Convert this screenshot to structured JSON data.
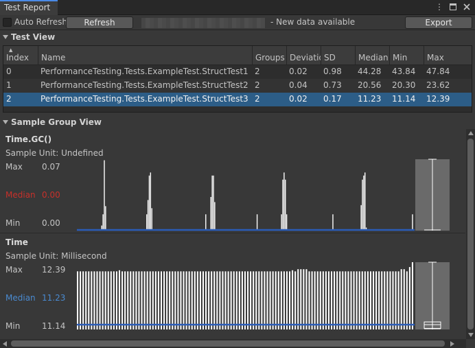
{
  "window": {
    "tab_title": "Test Report",
    "tab_controls": {
      "menu": "⋮"
    }
  },
  "toolbar": {
    "auto_refresh_label": "Auto Refresh",
    "refresh_label": "Refresh",
    "status_text": "- New data available",
    "export_label": "Export"
  },
  "test_view": {
    "title": "Test View",
    "columns": [
      "Index",
      "Name",
      "Groups",
      "Deviatio",
      "SD",
      "Median",
      "Min",
      "Max"
    ],
    "rows": [
      {
        "index": "0",
        "name": "PerformanceTesting.Tests.ExampleTest.StructTest1",
        "groups": "2",
        "deviation": "0.02",
        "sd": "0.98",
        "median": "44.28",
        "min": "43.84",
        "max": "47.84",
        "selected": false
      },
      {
        "index": "1",
        "name": "PerformanceTesting.Tests.ExampleTest.StructTest2",
        "groups": "2",
        "deviation": "0.04",
        "sd": "0.73",
        "median": "20.56",
        "min": "20.30",
        "max": "23.62",
        "selected": false
      },
      {
        "index": "2",
        "name": "PerformanceTesting.Tests.ExampleTest.StructTest3",
        "groups": "2",
        "deviation": "0.02",
        "sd": "0.17",
        "median": "11.23",
        "min": "11.14",
        "max": "12.39",
        "selected": true
      }
    ]
  },
  "sample_group_view": {
    "title": "Sample Group View",
    "groups": [
      {
        "title": "Time.GC()",
        "unit": "Sample Unit: Undefined",
        "max_label": "Max",
        "max_value": "0.07",
        "median_label": "Median",
        "median_value": "0.00",
        "min_label": "Min",
        "min_value": "0.00"
      },
      {
        "title": "Time",
        "unit": "Sample Unit: Millisecond",
        "max_label": "Max",
        "max_value": "12.39",
        "median_label": "Median",
        "median_value": "11.23",
        "min_label": "Min",
        "min_value": "11.14"
      }
    ]
  },
  "colors": {
    "selected_row": "#2c5d87",
    "median_line": "#2a5cb8",
    "median_red": "#c8302a",
    "median_blue": "#4a8ad0"
  },
  "chart_data": [
    {
      "type": "bar",
      "title": "Time.GC()",
      "ylim": [
        0.0,
        0.07
      ],
      "median": 0.0,
      "values": [
        0,
        0,
        0,
        0,
        0,
        0,
        0,
        0,
        0,
        0,
        0,
        0,
        0,
        0,
        0,
        0,
        0,
        0,
        0,
        0.005,
        0.016,
        0.069,
        0.024,
        0,
        0,
        0,
        0,
        0,
        0,
        0,
        0,
        0,
        0,
        0,
        0,
        0,
        0,
        0,
        0,
        0,
        0,
        0,
        0,
        0,
        0,
        0,
        0,
        0,
        0,
        0,
        0,
        0,
        0,
        0,
        0.016,
        0.03,
        0.054,
        0.057,
        0.022,
        0,
        0,
        0,
        0,
        0,
        0,
        0,
        0,
        0,
        0,
        0,
        0,
        0,
        0,
        0,
        0,
        0,
        0,
        0,
        0,
        0,
        0,
        0,
        0,
        0,
        0,
        0,
        0,
        0,
        0,
        0,
        0,
        0,
        0,
        0,
        0,
        0,
        0,
        0,
        0,
        0,
        0.016,
        0,
        0,
        0,
        0.033,
        0.054,
        0.054,
        0.028,
        0,
        0,
        0,
        0,
        0,
        0,
        0,
        0,
        0,
        0,
        0,
        0,
        0,
        0,
        0,
        0,
        0,
        0,
        0,
        0,
        0,
        0,
        0,
        0,
        0,
        0,
        0,
        0,
        0,
        0,
        0,
        0,
        0.016,
        0,
        0,
        0,
        0,
        0,
        0,
        0,
        0,
        0,
        0,
        0,
        0,
        0,
        0,
        0,
        0,
        0,
        0,
        0.016,
        0.05,
        0.057,
        0.05,
        0.016,
        0,
        0,
        0,
        0,
        0,
        0,
        0,
        0,
        0,
        0,
        0,
        0,
        0,
        0,
        0,
        0,
        0,
        0,
        0,
        0,
        0,
        0,
        0,
        0,
        0,
        0,
        0,
        0,
        0,
        0,
        0,
        0,
        0,
        0,
        0,
        0.016,
        0,
        0,
        0,
        0,
        0,
        0,
        0,
        0,
        0,
        0,
        0,
        0,
        0,
        0,
        0,
        0,
        0,
        0,
        0,
        0,
        0,
        0.025,
        0.05,
        0.054,
        0.057,
        0.003,
        0,
        0,
        0,
        0,
        0,
        0,
        0,
        0,
        0,
        0,
        0,
        0,
        0,
        0,
        0,
        0,
        0,
        0,
        0,
        0,
        0,
        0,
        0,
        0,
        0,
        0,
        0,
        0,
        0,
        0,
        0,
        0,
        0,
        0,
        0,
        0.016,
        0
      ],
      "box": {
        "min": 0.0,
        "q1": 0.0,
        "median": 0.0,
        "q3": 0.0,
        "max": 0.07
      }
    },
    {
      "type": "bar",
      "title": "Time",
      "ylim": [
        11.14,
        12.39
      ],
      "median": 11.23,
      "values": [
        12.22,
        12.22,
        12.22,
        12.22,
        12.22,
        12.22,
        12.22,
        12.22,
        12.22,
        12.22,
        12.22,
        12.22,
        12.22,
        12.22,
        12.22,
        12.24,
        12.22,
        12.22,
        12.22,
        12.22,
        12.22,
        12.22,
        12.22,
        12.22,
        12.22,
        12.22,
        12.22,
        12.22,
        12.22,
        12.22,
        12.22,
        12.22,
        12.22,
        12.22,
        12.22,
        12.22,
        12.22,
        12.22,
        12.22,
        12.22,
        12.22,
        12.22,
        12.22,
        12.22,
        12.22,
        12.22,
        12.22,
        12.22,
        12.22,
        12.22,
        12.22,
        12.22,
        12.22,
        12.22,
        12.22,
        12.22,
        12.22,
        12.22,
        12.22,
        12.22,
        12.22,
        12.22,
        12.22,
        12.22,
        12.22,
        12.22,
        12.22,
        12.22,
        12.22,
        12.22,
        12.22,
        12.22,
        12.22,
        12.22,
        12.22,
        12.22,
        12.22,
        12.24,
        12.22,
        12.26,
        12.26,
        12.26,
        12.26,
        12.22,
        12.22,
        12.22,
        12.22,
        12.22,
        12.22,
        12.22,
        12.22,
        12.22,
        12.22,
        12.22,
        12.22,
        12.22,
        12.22,
        12.22,
        12.22,
        12.22,
        12.22,
        12.22,
        12.22,
        12.22,
        12.22,
        12.22,
        12.22,
        12.22,
        12.22,
        12.22,
        12.22,
        12.22,
        12.22,
        12.22,
        12.22,
        12.22,
        12.26,
        12.26,
        12.22,
        12.3,
        12.39
      ],
      "box": {
        "min": 11.14,
        "q1": 11.16,
        "median": 11.23,
        "q3": 11.28,
        "max": 12.39
      }
    }
  ]
}
